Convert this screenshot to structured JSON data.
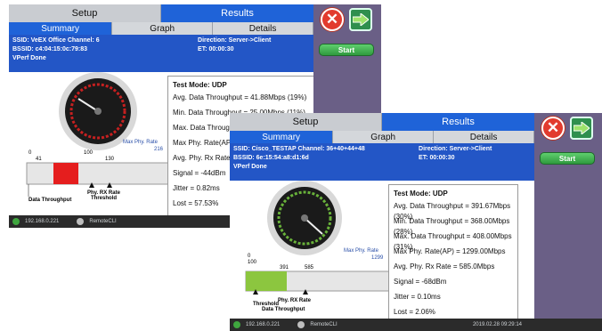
{
  "back": {
    "tabs": [
      "Setup",
      "Results"
    ],
    "subtabs": [
      "Summary",
      "Graph",
      "Details"
    ],
    "info_left": [
      "SSID: VeEX Office   Channel: 6",
      "BSSID: c4:04:15:0c:79:83",
      "VPerf Done"
    ],
    "info_right": [
      "Direction: Server->Client",
      "ET: 00:00:30"
    ],
    "start": "Start",
    "gauge": {
      "scale_min": "0",
      "mark_100": "100",
      "max_label_1": "Max Phy. Rate",
      "max_label_2": "216"
    },
    "bar": {
      "value_label": "41",
      "rx_label": "130",
      "fill_color": "#e51e1e",
      "data_throughput": "Data Throughput",
      "phy_rx_rate": "Phy. RX Rate",
      "threshold": "Threshold"
    },
    "results": [
      "Test Mode: UDP",
      "Avg. Data Throughput = 41.88Mbps (19%)",
      "Min. Data Throughput = 25.00Mbps (11%)",
      "Max. Data Throughp",
      "Max Phy. Rate(AP)",
      "Avg. Phy. Rx Rate =",
      "Signal = -44dBm",
      "Jitter = 0.82ms",
      "Lost = 57.53%"
    ],
    "status": {
      "ip": "192.168.0.221",
      "remote": "RemoteCLI"
    }
  },
  "front": {
    "tabs": [
      "Setup",
      "Results"
    ],
    "subtabs": [
      "Summary",
      "Graph",
      "Details"
    ],
    "info_left": [
      "SSID: Cisco_TESTAP   Channel: 36+40+44+48",
      "BSSID: 6e:15:54:a8:d1:6d",
      "VPerf Done"
    ],
    "info_right": [
      "Direction: Server->Client",
      "ET: 00:00:30"
    ],
    "start": "Start",
    "gauge": {
      "scale_min": "0",
      "mark_100": "100",
      "max_label_1": "Max Phy. Rate",
      "max_label_2": "1299"
    },
    "bar": {
      "value_label": "391",
      "rx_label": "585",
      "fill_color": "#8cc63f",
      "data_throughput": "Data Throughput",
      "phy_rx_rate": "Phy. RX Rate",
      "threshold": "Threshold"
    },
    "results": [
      "Test Mode: UDP",
      "Avg. Data Throughput = 391.67Mbps (30%)",
      "Min. Data Throughput = 368.00Mbps (28%)",
      "Max. Data Throughput = 408.00Mbps (31%)",
      "Max Phy. Rate(AP) = 1299.00Mbps",
      "Avg. Phy. Rx Rate = 585.0Mbps",
      "Signal = -68dBm",
      "Jitter = 0.10ms",
      "Lost = 2.06%"
    ],
    "status": {
      "ip": "192.168.0.221",
      "remote": "RemoteCLI",
      "datetime": "2019.02.28 09:29:14"
    }
  }
}
